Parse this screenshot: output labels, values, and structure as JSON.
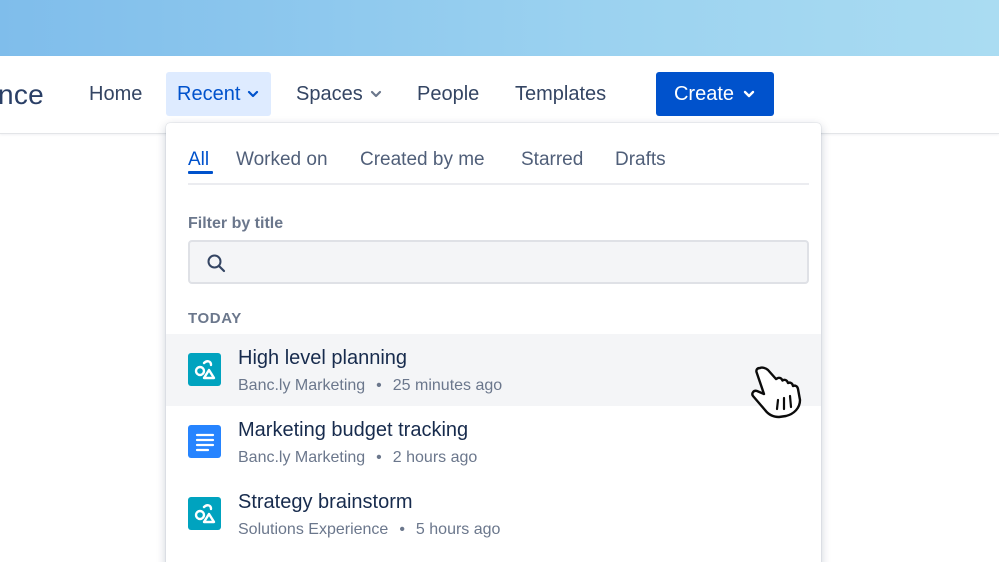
{
  "logo": {
    "partial_text": "nce"
  },
  "nav": {
    "items": [
      {
        "label": "Home"
      },
      {
        "label": "Recent"
      },
      {
        "label": "Spaces"
      },
      {
        "label": "People"
      },
      {
        "label": "Templates"
      }
    ],
    "create_label": "Create"
  },
  "colors": {
    "accent": "#0052cc",
    "active_nav_bg": "#deebff",
    "whiteboard_icon": "#00a3bf",
    "page_icon": "#2684ff",
    "hover_row": "#f4f5f7",
    "top_band": "#8fc8ee"
  },
  "dropdown": {
    "tabs": [
      {
        "label": "All",
        "active": true
      },
      {
        "label": "Worked on"
      },
      {
        "label": "Created by me"
      },
      {
        "label": "Starred"
      },
      {
        "label": "Drafts"
      }
    ],
    "filter": {
      "label": "Filter by title",
      "value": "",
      "icon": "search-icon"
    },
    "section_label": "TODAY",
    "items": [
      {
        "title": "High level planning",
        "space": "Banc.ly Marketing",
        "separator": "•",
        "time": "25 minutes ago",
        "icon": "whiteboard-icon"
      },
      {
        "title": "Marketing budget tracking",
        "space": "Banc.ly Marketing",
        "separator": "•",
        "time": "2 hours ago",
        "icon": "page-icon"
      },
      {
        "title": "Strategy brainstorm",
        "space": "Solutions Experience",
        "separator": "•",
        "time": "5 hours ago",
        "icon": "whiteboard-icon"
      }
    ]
  },
  "cursor": {
    "icon": "pointer-hand-icon"
  }
}
